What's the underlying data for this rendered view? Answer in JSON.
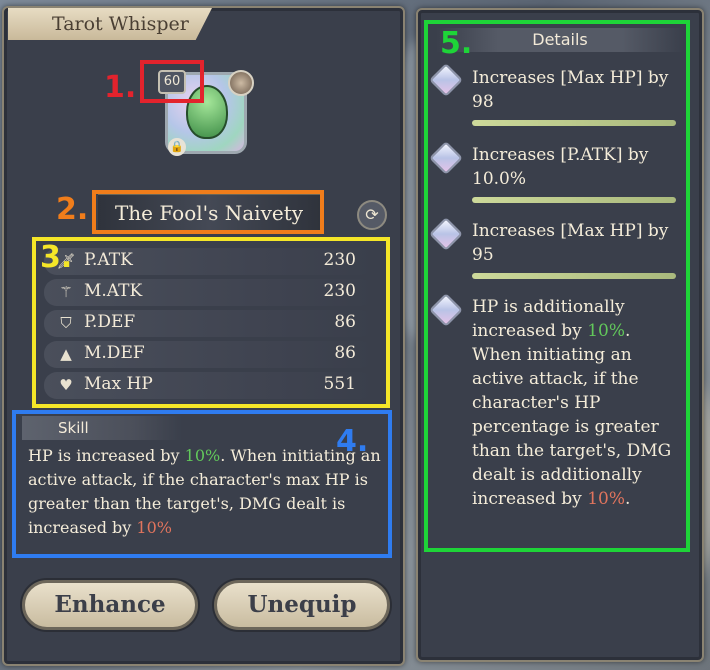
{
  "window": {
    "title": "Tarot Whisper"
  },
  "controls": {
    "close_glyph": "✕",
    "lock_glyph": "🔒"
  },
  "item": {
    "level": "60",
    "name": "The Fool's Naivety",
    "refresh_glyph": "⟳"
  },
  "stats": [
    {
      "label": "P.ATK",
      "value": "230",
      "icon": "sword-icon"
    },
    {
      "label": "M.ATK",
      "value": "230",
      "icon": "staff-icon"
    },
    {
      "label": "P.DEF",
      "value": "86",
      "icon": "shield-icon"
    },
    {
      "label": "M.DEF",
      "value": "86",
      "icon": "hat-icon"
    },
    {
      "label": "Max HP",
      "value": "551",
      "icon": "heart-icon"
    }
  ],
  "skill": {
    "title": "Skill",
    "text_before": "HP is increased by ",
    "value1": "10%",
    "text_middle": ". When initiating an active attack, if the character's max HP is greater than the target's, DMG dealt is increased by ",
    "value2": "10%"
  },
  "buttons": {
    "enhance": "Enhance",
    "unequip": "Unequip"
  },
  "details": {
    "title": "Details",
    "entries": [
      {
        "text": "Increases [Max HP] by 98"
      },
      {
        "text": "Increases [P.ATK] by 10.0%"
      },
      {
        "text": "Increases [Max HP] by 95"
      }
    ],
    "special": {
      "before": "HP is additionally increased by ",
      "value1": "10%",
      "middle": ". When initiating an active attack, if the character's HP percentage is greater than the target's, DMG dealt is additionally increased by ",
      "value2": "10%",
      "after": "."
    }
  },
  "annotations": [
    "1.",
    "2.",
    "3.",
    "4.",
    "5."
  ],
  "colors": {
    "anno1": "#e3232d",
    "anno2": "#f07d1b",
    "anno3": "#f5e628",
    "anno4": "#2f7cf0",
    "anno5": "#1ed438",
    "highlight_green": "#62c85b",
    "highlight_red": "#e0745d"
  }
}
